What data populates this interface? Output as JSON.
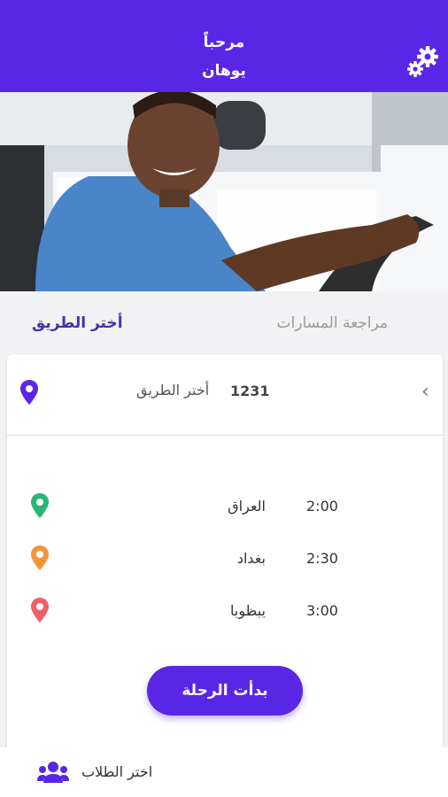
{
  "header": {
    "greeting": "مرحباً",
    "username": "يوهان",
    "settings_icon": "gear-icon",
    "background": "#5a26e6"
  },
  "hero": {
    "description_icon": "driver-photo"
  },
  "tabs": {
    "review": "مراجعة المسارات",
    "choose": "أختر الطريق"
  },
  "route": {
    "number": "1231",
    "label": "أختر الطريق",
    "chevron": "‹",
    "pin_color": "#5a26e6"
  },
  "stops": [
    {
      "time": "2:00",
      "name": "العراق",
      "pin_color": "#2bb673"
    },
    {
      "time": "2:30",
      "name": "بغداد",
      "pin_color": "#f5943a"
    },
    {
      "time": "3:00",
      "name": "يبظوبا",
      "pin_color": "#ee5f6a"
    }
  ],
  "start_button": "بدأت الرحلة",
  "bottom": {
    "students_label": "اختر الطلاب",
    "icon": "users-icon"
  }
}
